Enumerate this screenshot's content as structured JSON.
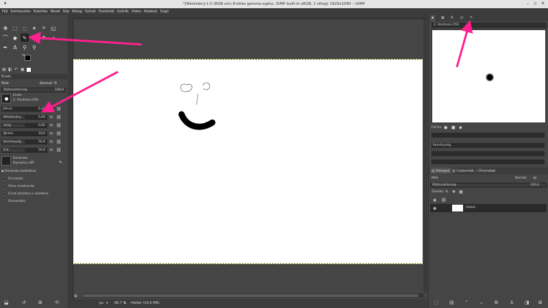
{
  "window": {
    "title": "*[Névtelen]-1.0 (RGB szín 8-bites gamma egész, GIMP built-in sRGB, 1 réteg) 1920x1080 – GIMP"
  },
  "menubar": [
    "Fájl",
    "Szerkesztés",
    "Kijelölés",
    "Nézet",
    "Kép",
    "Réteg",
    "Színek",
    "Eszközök",
    "Szűrők",
    "Video",
    "Ablakok",
    "Súgó"
  ],
  "tool_options": {
    "header": "Ecset",
    "mode_label": "Mód",
    "mode_value": "Normál",
    "opacity_label": "Átlátszatlanság",
    "opacity_value": "100,0",
    "brush_label": "Ecset",
    "brush_name": "2. Hardness 050",
    "size": {
      "label": "Méret",
      "value": "6,00",
      "fraction": 0.04
    },
    "aspect": {
      "label": "Méretarány",
      "value": "0,00",
      "fraction": 0.5
    },
    "angle": {
      "label": "Szög",
      "value": "0,00",
      "fraction": 0.5
    },
    "spacing": {
      "label": "Térköz",
      "value": "10,0",
      "fraction": 0.1
    },
    "hardness": {
      "label": "Keménység",
      "value": "50,0",
      "fraction": 0.5
    },
    "force": {
      "label": "Erő",
      "value": "50,0",
      "fraction": 0.5
    },
    "dynamics_label": "Dinamika",
    "dynamics_value": "Dynamics Off",
    "dynamics_options_label": "Dinamika beállításai",
    "check_fade": "Elcsúszás",
    "check_smooth": "Sima ecsetvonás",
    "check_lock": "Ecset zárolása a nézethez",
    "check_incremental": "Összesítési"
  },
  "canvas": {
    "unit": "px",
    "zoom": "66,7 %",
    "status": "Háttér (29,6 MB)"
  },
  "brushes_panel": {
    "brush_title": "2. Hardness 050",
    "filter_label": "Forma",
    "spacing_label": "Keménység"
  },
  "layers_panel": {
    "tab_layers": "Rétegek",
    "tab_channels": "Csatornák",
    "tab_paths": "Útvonalak",
    "mode_label": "Mód",
    "mode_value": "Normál",
    "opacity_label": "Átlátszatlanság",
    "opacity_value": "100,0",
    "lock_label": "Zárolás:",
    "layer_name": "Háttér"
  },
  "colors": {
    "arrow": "#ff1f8e",
    "bg_dark": "#454545",
    "canvas": "#ffffff"
  }
}
